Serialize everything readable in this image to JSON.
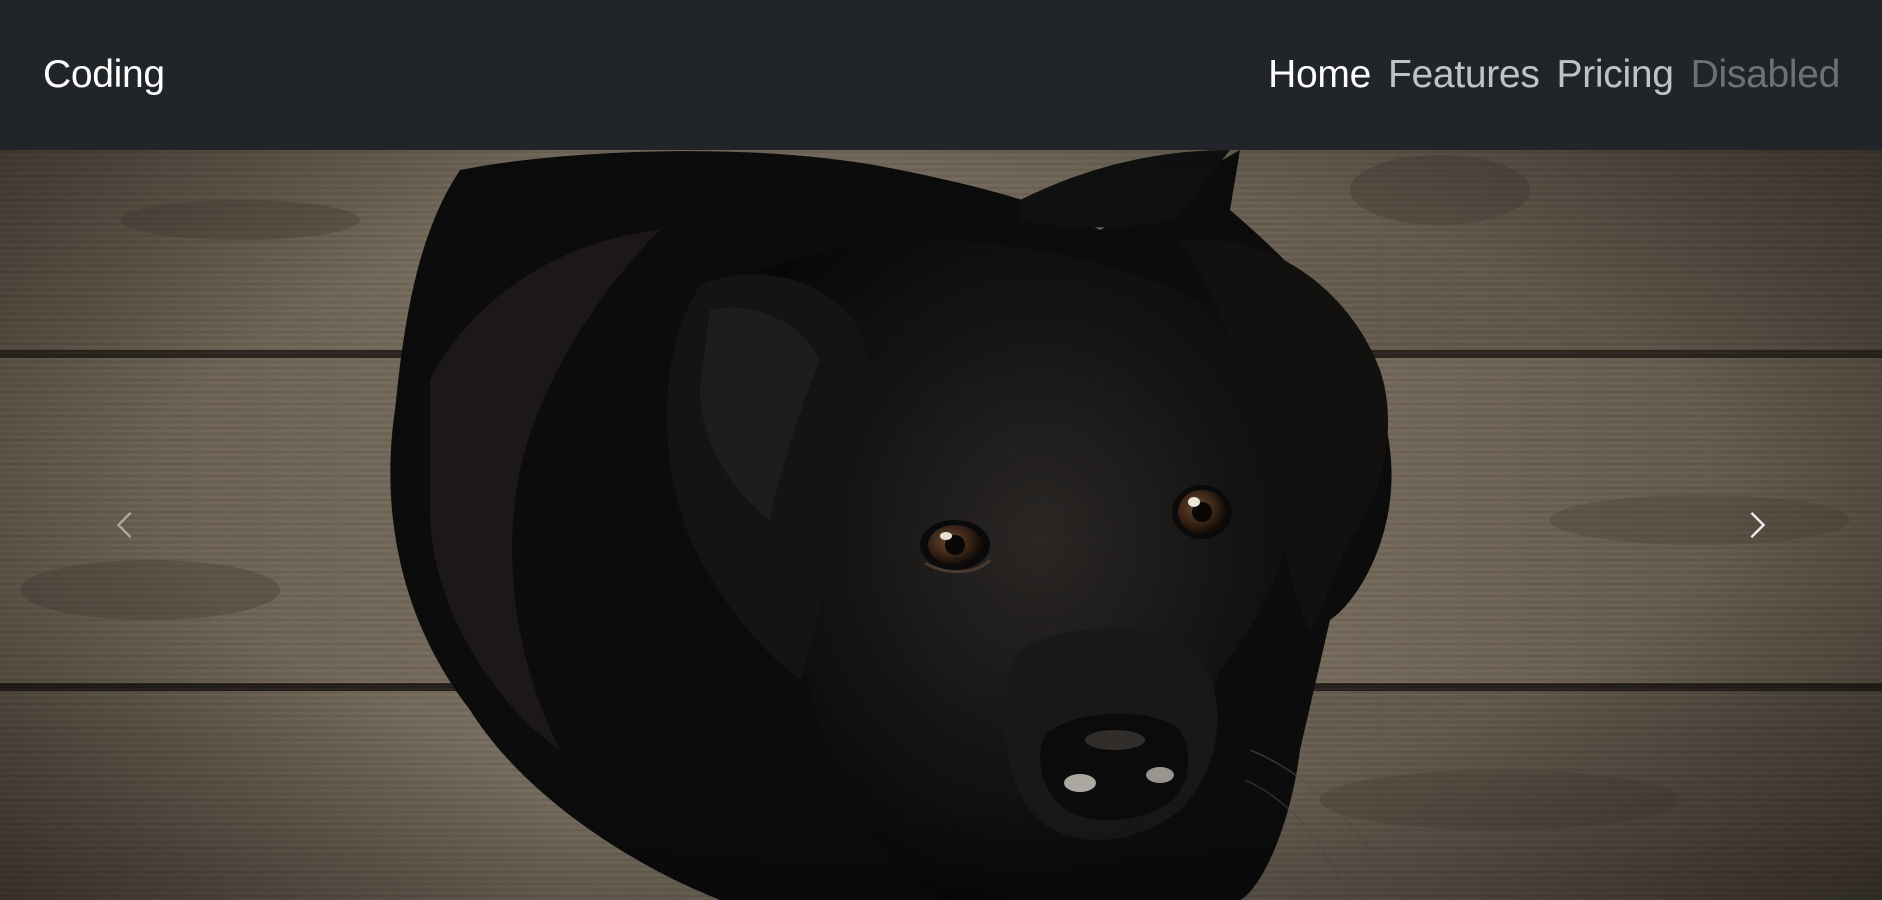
{
  "navbar": {
    "brand": "Coding",
    "links": [
      {
        "label": "Home",
        "state": "active"
      },
      {
        "label": "Features",
        "state": "normal"
      },
      {
        "label": "Pricing",
        "state": "normal"
      },
      {
        "label": "Disabled",
        "state": "disabled"
      }
    ]
  },
  "carousel": {
    "slide_subject": "black-labrador-puppy-on-wooden-floor",
    "controls": {
      "prev_icon": "chevron-left-icon",
      "next_icon": "chevron-right-icon"
    }
  },
  "colors": {
    "navbar_bg": "#212529",
    "link_active": "#ffffff",
    "link_normal": "rgba(255,255,255,0.72)",
    "link_disabled": "rgba(255,255,255,0.35)"
  }
}
